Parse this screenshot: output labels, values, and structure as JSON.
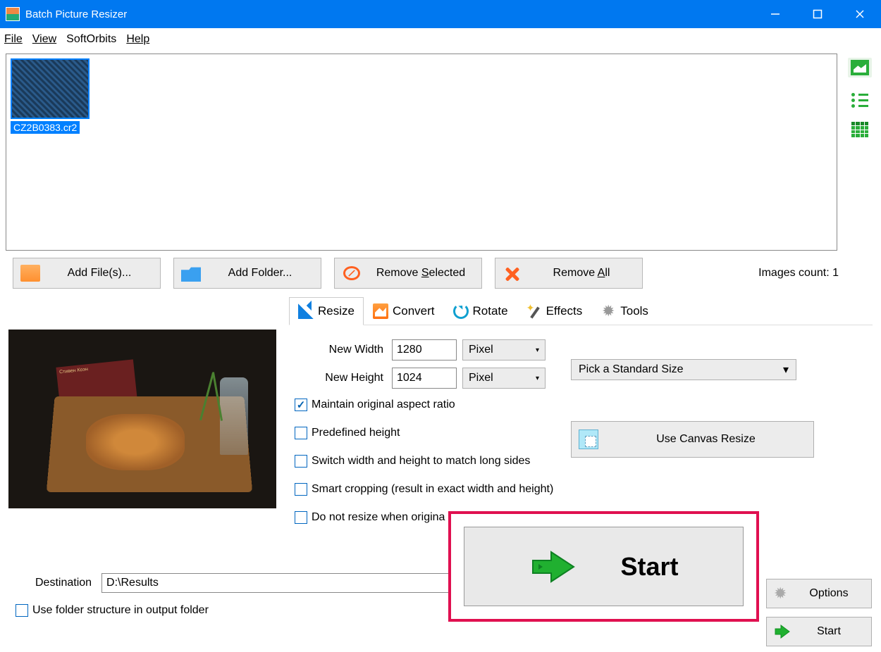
{
  "window": {
    "title": "Batch Picture Resizer"
  },
  "menu": {
    "file": "File",
    "view": "View",
    "softorbits": "SoftOrbits",
    "help": "Help"
  },
  "thumbnails": [
    {
      "filename": "CZ2B0383.cr2"
    }
  ],
  "actions": {
    "add_files": "Add File(s)...",
    "add_folder": "Add Folder...",
    "remove_selected_pre": "Remove ",
    "remove_selected_ul": "S",
    "remove_selected_post": "elected",
    "remove_all_pre": "Remove ",
    "remove_all_ul": "A",
    "remove_all_post": "ll"
  },
  "images_count": {
    "label": "Images count: ",
    "value": "1"
  },
  "tabs": {
    "resize": "Resize",
    "convert": "Convert",
    "rotate": "Rotate",
    "effects": "Effects",
    "tools": "Tools"
  },
  "resize": {
    "new_width_label": "New Width",
    "new_width_value": "1280",
    "new_height_label": "New Height",
    "new_height_value": "1024",
    "unit": "Pixel",
    "standard_size": "Pick a Standard Size",
    "canvas_resize": "Use Canvas Resize",
    "maintain_ratio": "Maintain original aspect ratio",
    "predefined_height": "Predefined height",
    "switch_wh": "Switch width and height to match long sides",
    "smart_crop": "Smart cropping (result in exact width and height)",
    "no_resize": "Do not resize when origina"
  },
  "preview_book_text": "Стивен Коэн",
  "destination": {
    "label": "Destination",
    "value": "D:\\Results"
  },
  "folder_structure": "Use folder structure in output folder",
  "buttons": {
    "options": "Options",
    "start": "Start",
    "big_start": "Start"
  }
}
